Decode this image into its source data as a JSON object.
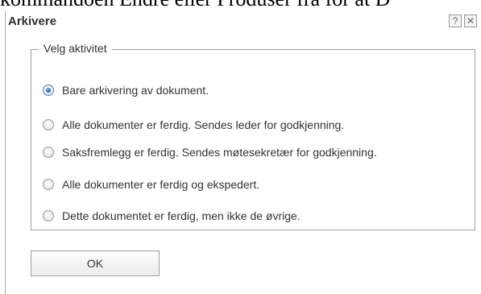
{
  "background_text": "kommandoen Endre eller Produser fra for at D",
  "dialog": {
    "title": "Arkivere",
    "help_icon_glyph": "?",
    "close_icon_glyph": "✕",
    "fieldset_legend": "Velg aktivitet",
    "options": [
      {
        "label": "Bare arkivering av dokument.",
        "checked": true
      },
      {
        "label": "Alle dokumenter er ferdig. Sendes leder for godkjenning.",
        "checked": false
      },
      {
        "label": "Saksfremlegg er ferdig. Sendes møtesekretær for godkjenning.",
        "checked": false
      },
      {
        "label": "Alle dokumenter er ferdig og ekspedert.",
        "checked": false
      },
      {
        "label": "Dette dokumentet er ferdig, men ikke de øvrige.",
        "checked": false
      }
    ],
    "ok_label": "OK"
  },
  "icons": {
    "help": "help-icon",
    "close": "close-icon"
  },
  "colors": {
    "selected_radio": "#2a64b0"
  }
}
